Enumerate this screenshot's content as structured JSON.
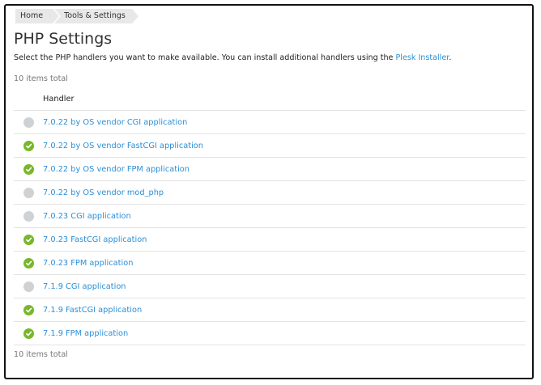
{
  "breadcrumb": [
    {
      "label": "Home"
    },
    {
      "label": "Tools & Settings"
    }
  ],
  "page": {
    "title": "PHP Settings",
    "description_text": "Select the PHP handlers you want to make available. You can install additional handlers using the ",
    "description_link": "Plesk Installer",
    "description_end": ".",
    "items_total": "10 items total"
  },
  "table": {
    "header": "Handler",
    "rows": [
      {
        "label": "7.0.22 by OS vendor CGI application",
        "enabled": false
      },
      {
        "label": "7.0.22 by OS vendor FastCGI application",
        "enabled": true
      },
      {
        "label": "7.0.22 by OS vendor FPM application",
        "enabled": true
      },
      {
        "label": "7.0.22 by OS vendor mod_php",
        "enabled": false
      },
      {
        "label": "7.0.23 CGI application",
        "enabled": false
      },
      {
        "label": "7.0.23 FastCGI application",
        "enabled": true
      },
      {
        "label": "7.0.23 FPM application",
        "enabled": true
      },
      {
        "label": "7.1.9 CGI application",
        "enabled": false
      },
      {
        "label": "7.1.9 FastCGI application",
        "enabled": true
      },
      {
        "label": "7.1.9 FPM application",
        "enabled": true
      }
    ]
  },
  "colors": {
    "link": "#2b8fd6",
    "enabled": "#78b72a",
    "disabled": "#cfd2d4"
  },
  "icons": {
    "enabled": "check-circle-icon",
    "disabled": "gray-circle-icon"
  }
}
